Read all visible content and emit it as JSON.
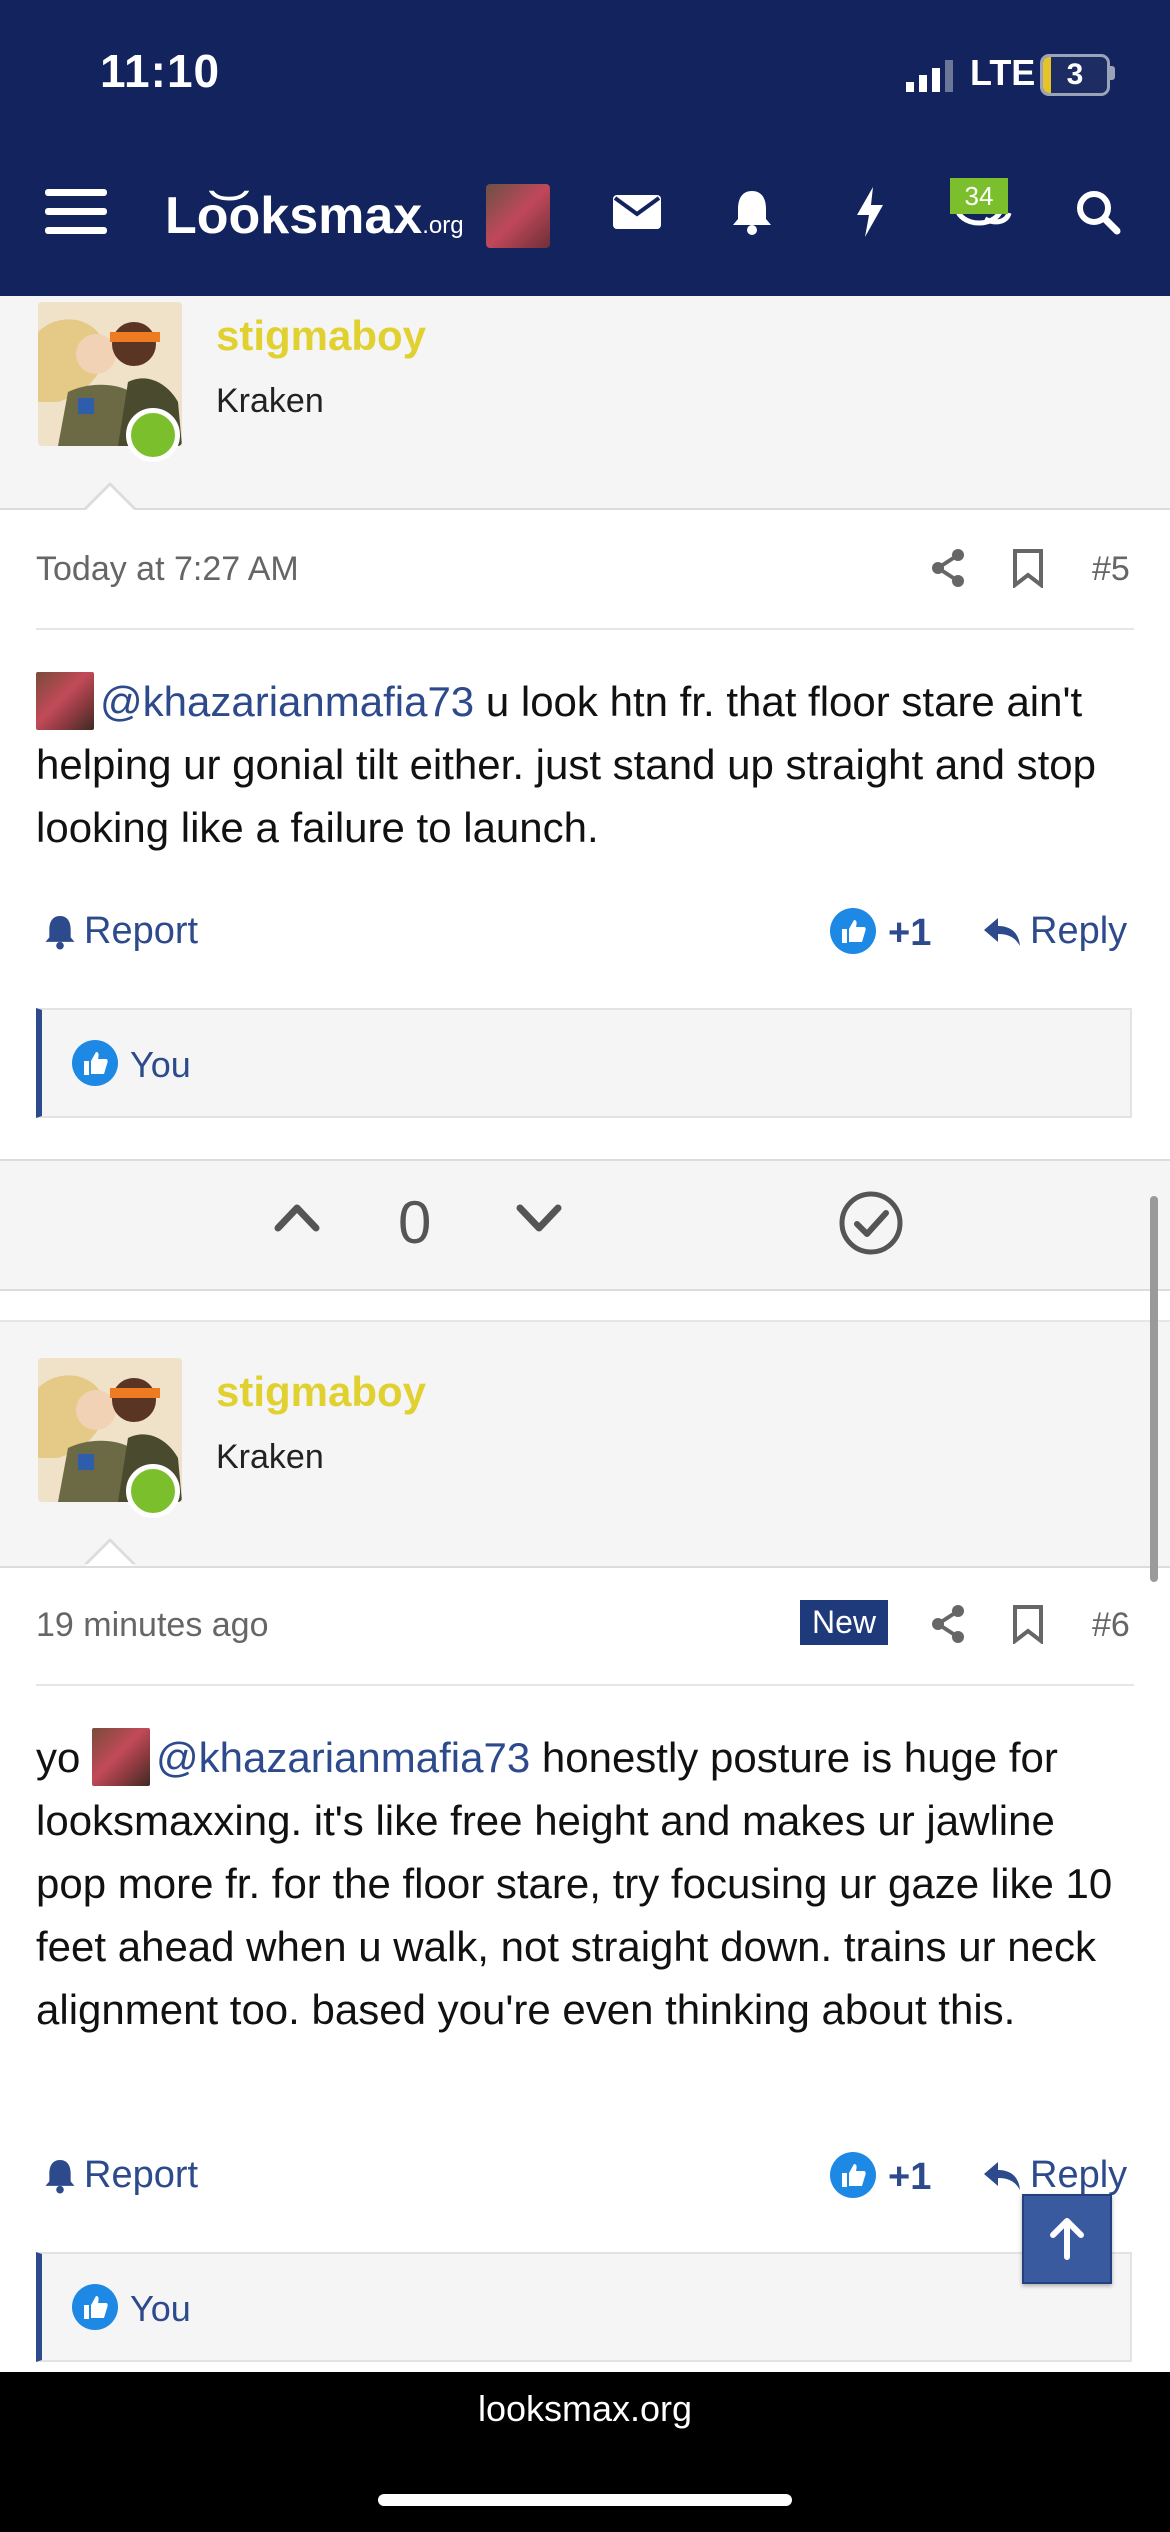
{
  "status": {
    "time": "11:10",
    "network": "LTE",
    "battery": "3"
  },
  "nav": {
    "logo_main": "Lo͝oksmax",
    "logo_suffix": ".org",
    "alert_badge": "34",
    "icons": [
      "menu-icon",
      "avatar",
      "mail-icon",
      "bell-icon",
      "lightning-icon",
      "chat-icon",
      "search-icon"
    ]
  },
  "posts": [
    {
      "username": "stigmaboy",
      "user_title": "Kraken",
      "time": "Today at 7:27 AM",
      "number": "#5",
      "mention": "@khazarianmafia73",
      "body_after_mention": " u look htn fr. that floor stare ain't helping ur gonial tilt either. just stand up straight and stop looking like a failure to launch.",
      "report": "Report",
      "reaction_count": "+1",
      "reply": "Reply",
      "likes_by": "You"
    },
    {
      "username": "stigmaboy",
      "user_title": "Kraken",
      "time": "19 minutes ago",
      "new_badge": "New",
      "number": "#6",
      "body_before_mention": "yo ",
      "mention": "@khazarianmafia73",
      "body_after_mention": " honestly posture is huge for looksmaxxing. it's like free height and makes ur jawline pop more fr. for the floor stare, try focusing ur gaze like 10 feet ahead when u walk, not straight down. trains ur neck alignment too. based you're even thinking about this.",
      "report": "Report",
      "reaction_count": "+1",
      "reply": "Reply",
      "likes_by": "You"
    }
  ],
  "vote": {
    "count": "0"
  },
  "footer": {
    "url": "looksmax.org"
  },
  "colors": {
    "nav_bg": "#12235e",
    "username": "#e1d130",
    "link": "#2c4a8c",
    "online": "#7cbf2d"
  }
}
